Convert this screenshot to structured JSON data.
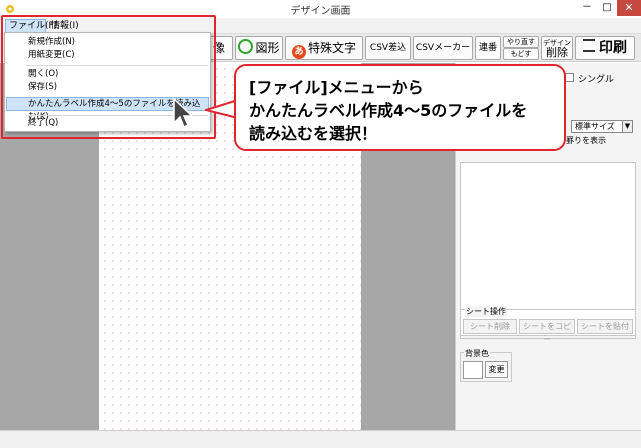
{
  "window": {
    "title": "デザイン画面",
    "minimize": "－",
    "maximize": "□",
    "close": "✕"
  },
  "menubar": {
    "file": "ファイル(F)",
    "info": "情報(I)"
  },
  "file_menu": {
    "items": [
      "新規作成(N)",
      "用紙変更(C)",
      "開く(O)",
      "保存(S)",
      "かんたんラベル作成4～5のファイルを読み込む(K)",
      "終了(Q)"
    ]
  },
  "toolbar": {
    "image_partial": "像",
    "shape": "図形",
    "special_char": "特殊文字",
    "special_char_icon_text": "あ",
    "csv_insert": "CSV差込",
    "csv_maker": "CSVメーカー",
    "serial": "連番",
    "redo": "やり直す",
    "undo": "もどす",
    "design_delete_top": "デザイン",
    "design_delete_bottom": "削除",
    "print": "印刷"
  },
  "props": {
    "single": "シングル",
    "size_value": "標準サイズ",
    "border_text": "罫りを表示",
    "sheet_ops_legend": "シート操作",
    "sheet_delete": "シート削除",
    "sheet_copy": "シートをコピー",
    "sheet_paste": "シートを貼付",
    "bg_legend": "背景色",
    "bg_change": "変更"
  },
  "callout": {
    "line1": "[ファイル]メニューから",
    "line2": "かんたんラベル作成4～5のファイルを",
    "line3": "読み込むを選択！"
  },
  "colors": {
    "accent_red": "#e0262c",
    "highlight": "#cfe3f7",
    "work_gray": "#a7a7a7"
  }
}
